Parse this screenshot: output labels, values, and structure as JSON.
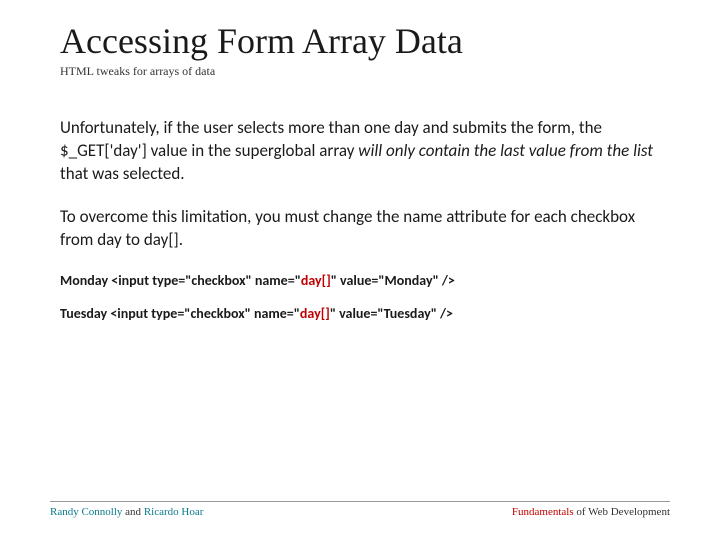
{
  "title": "Accessing Form Array Data",
  "subtitle": "HTML tweaks for arrays of data",
  "paragraph1": {
    "part1": "Unfortunately, if the user selects more than one day and submits the form, the $_GET['day'] value in the superglobal array ",
    "italic": "will only contain the last value from the list",
    "part2": " that was selected."
  },
  "paragraph2": "To overcome this limitation, you must change the name attribute for each checkbox from day to day[].",
  "code1": {
    "prefix": "Monday <input type=\"checkbox\" name=\"",
    "highlight": "day[]",
    "suffix": "\" value=\"Monday\" />"
  },
  "code2": {
    "prefix": "Tuesday <input type=\"checkbox\" name=\"",
    "highlight": "day[]",
    "suffix": "\" value=\"Tuesday\" />"
  },
  "footer": {
    "author1": "Randy Connolly ",
    "and": "and ",
    "author2": "Ricardo Hoar",
    "book_hl": "Fundamentals ",
    "book_rest": "of Web Development"
  }
}
